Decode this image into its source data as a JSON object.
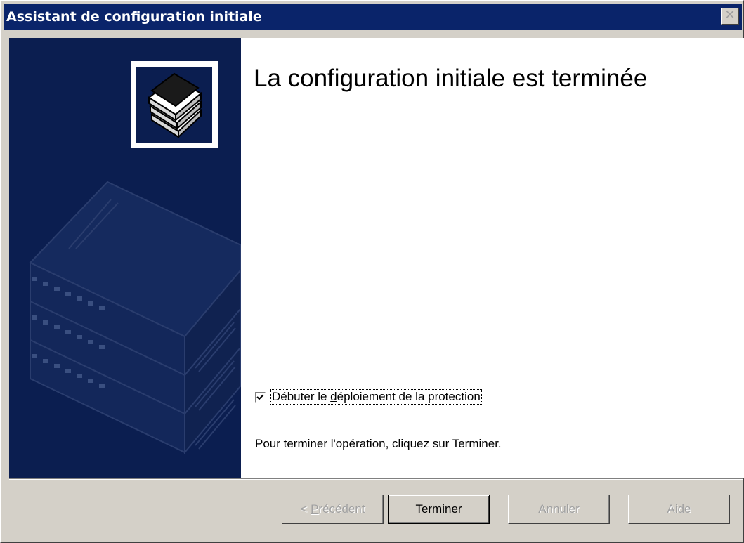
{
  "window": {
    "title": "Assistant de configuration initiale",
    "close_glyph": "✕"
  },
  "content": {
    "heading": "La configuration initiale est terminée",
    "checkbox": {
      "label_pre": "Débuter le ",
      "label_underlined": "d",
      "label_post": "éploiement de la protection",
      "checked": true
    },
    "info_text": "Pour terminer l'opération, cliquez sur Terminer."
  },
  "buttons": {
    "prev_lt": "< ",
    "prev_underlined": "P",
    "prev_rest": "récédent",
    "finish": "Terminer",
    "cancel": "Annuler",
    "help": "Aide"
  },
  "colors": {
    "titlebar": "#0a246a",
    "side_panel": "#0b1e50",
    "dialog_face": "#d4d0c8"
  },
  "icons": {
    "side_graphic": "server-stack-icon",
    "wizard_icon": "book-stack-icon"
  }
}
